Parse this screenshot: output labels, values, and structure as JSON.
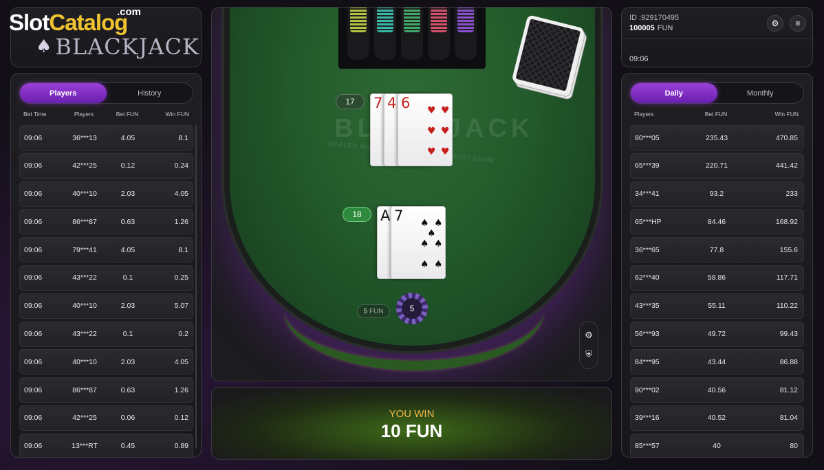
{
  "watermark": {
    "part1": "Slot",
    "part2": "Catalog",
    "suffix": ".com"
  },
  "logo": {
    "text": "BLACKJACK"
  },
  "account": {
    "id": "ID :929170495",
    "balance": "100005",
    "currency": "FUN",
    "time": "09:06"
  },
  "left_board": {
    "tabs": [
      "Players",
      "History"
    ],
    "active_tab": "Players",
    "headers": [
      "Bet Time",
      "Players",
      "Bet FUN",
      "Win FUN"
    ],
    "rows": [
      [
        "09:06",
        "36***13",
        "4.05",
        "8.1"
      ],
      [
        "09:06",
        "42***25",
        "0.12",
        "0.24"
      ],
      [
        "09:06",
        "40***10",
        "2.03",
        "4.05"
      ],
      [
        "09:06",
        "86***87",
        "0.63",
        "1.26"
      ],
      [
        "09:06",
        "79***41",
        "4.05",
        "8.1"
      ],
      [
        "09:06",
        "43***22",
        "0.1",
        "0.25"
      ],
      [
        "09:06",
        "40***10",
        "2.03",
        "5.07"
      ],
      [
        "09:06",
        "43***22",
        "0.1",
        "0.2"
      ],
      [
        "09:06",
        "40***10",
        "2.03",
        "4.05"
      ],
      [
        "09:06",
        "86***87",
        "0.63",
        "1.26"
      ],
      [
        "09:06",
        "42***25",
        "0.06",
        "0.12"
      ],
      [
        "09:06",
        "13***RT",
        "0.45",
        "0.89"
      ]
    ]
  },
  "right_board": {
    "tabs": [
      "Daily",
      "Monthly"
    ],
    "active_tab": "Daily",
    "headers": [
      "Players",
      "Bet FUN",
      "Win FUN"
    ],
    "rows": [
      [
        "80***05",
        "235.43",
        "470.85"
      ],
      [
        "65***39",
        "220.71",
        "441.42"
      ],
      [
        "34***41",
        "93.2",
        "233"
      ],
      [
        "65***HP",
        "84.46",
        "168.92"
      ],
      [
        "36***65",
        "77.8",
        "155.6"
      ],
      [
        "62***40",
        "58.86",
        "117.71"
      ],
      [
        "43***35",
        "55.11",
        "110.22"
      ],
      [
        "56***93",
        "49.72",
        "99.43"
      ],
      [
        "84***95",
        "43.44",
        "86.88"
      ],
      [
        "90***02",
        "40.56",
        "81.12"
      ],
      [
        "39***16",
        "40.52",
        "81.04"
      ],
      [
        "85***57",
        "40",
        "80"
      ]
    ]
  },
  "table": {
    "title": "BLACKJACK",
    "rule": "DEALER MUST STAND TO 17, AND MUST DRAW TO 16",
    "dealer_score": "17",
    "player_score": "18",
    "dealer_cards": [
      {
        "rank": "7",
        "suit": "♥",
        "color": "red"
      },
      {
        "rank": "4",
        "suit": "♥",
        "color": "red"
      },
      {
        "rank": "6",
        "suit": "♥",
        "color": "red"
      }
    ],
    "player_cards": [
      {
        "rank": "A",
        "suit": "♠",
        "color": "black"
      },
      {
        "rank": "7",
        "suit": "♠",
        "color": "black"
      }
    ],
    "bet_amount": "5",
    "bet_currency": "FUN",
    "chip_value": "5",
    "chip_colors": [
      "#b3c240",
      "#34b8a8",
      "#3fa867",
      "#d4506a",
      "#8a4fd0"
    ]
  },
  "result": {
    "label": "YOU WIN",
    "amount": "10",
    "currency": "FUN"
  },
  "icons": {
    "settings": "gear-icon",
    "menu": "menu-icon",
    "table_settings": "gear-icon",
    "fairness": "shield-icon"
  }
}
